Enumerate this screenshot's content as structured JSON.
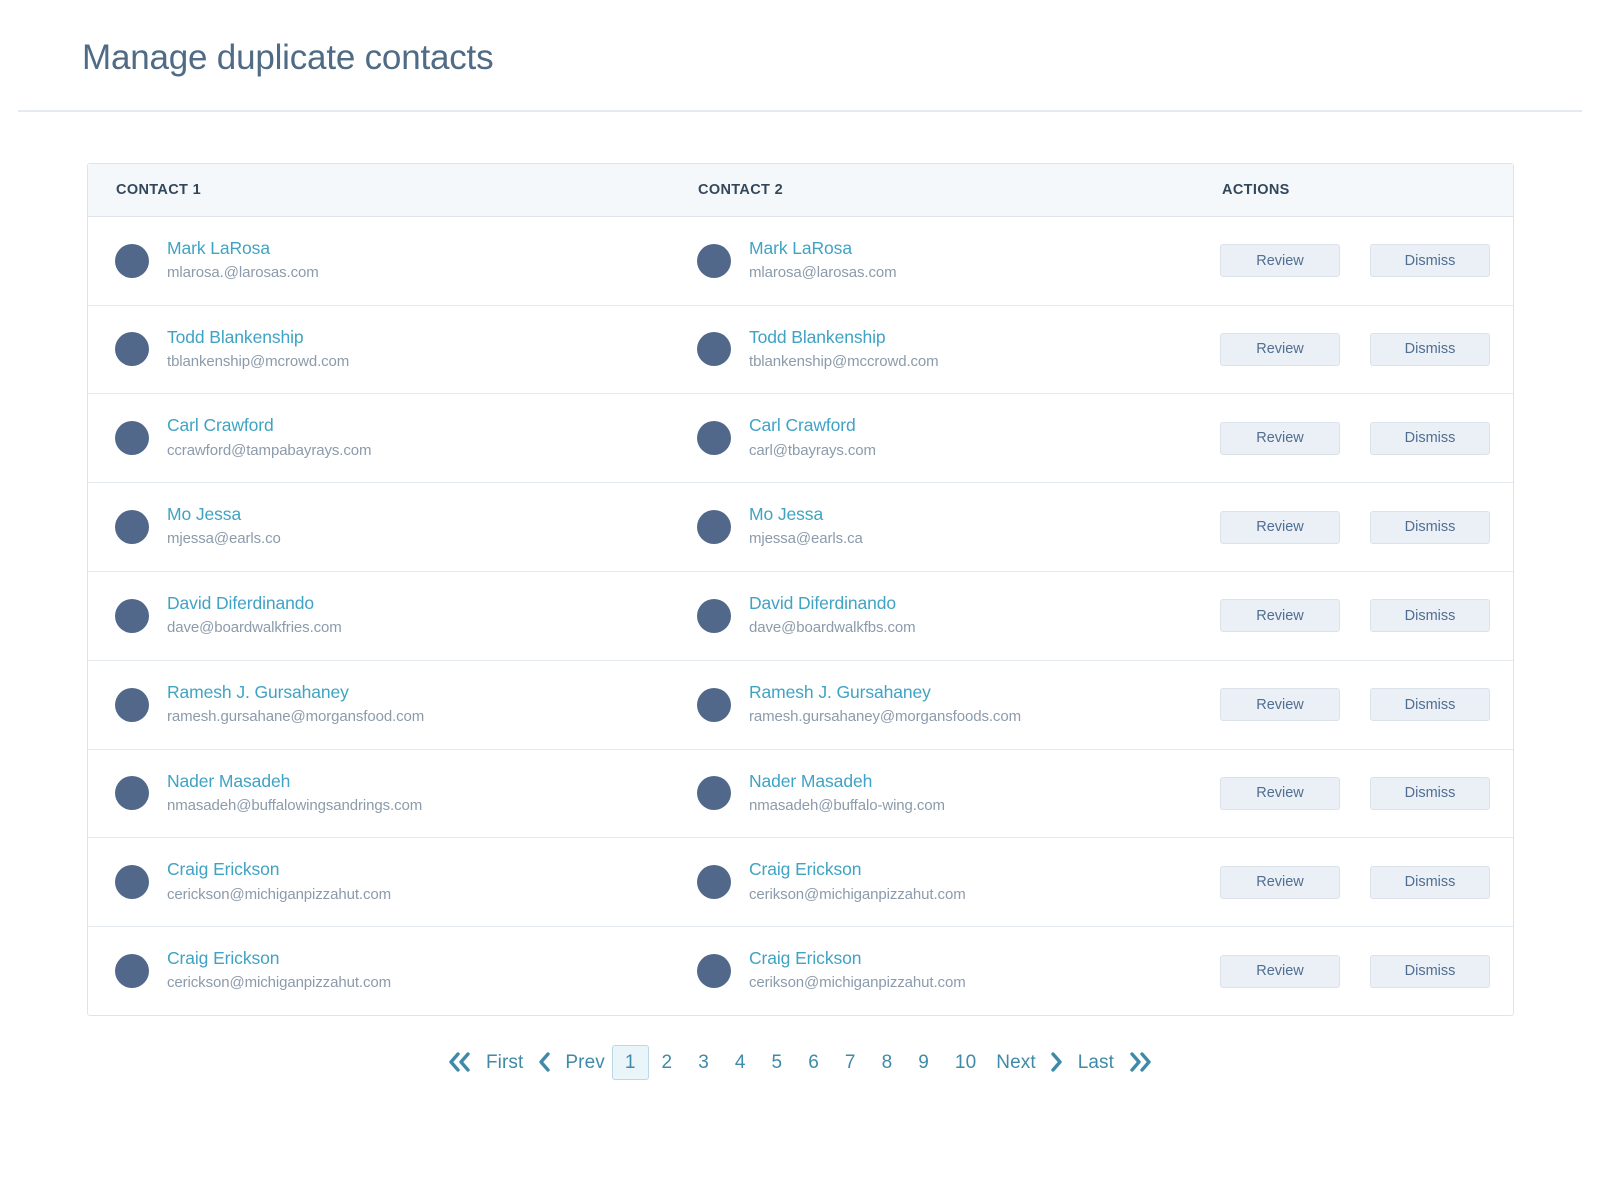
{
  "page": {
    "title": "Manage duplicate contacts"
  },
  "table": {
    "headers": {
      "contact1": "CONTACT 1",
      "contact2": "CONTACT 2",
      "actions": "ACTIONS"
    },
    "actions": {
      "review_label": "Review",
      "dismiss_label": "Dismiss"
    },
    "rows": [
      {
        "contact1": {
          "name": "Mark LaRosa",
          "email": "mlarosa.@larosas.com"
        },
        "contact2": {
          "name": "Mark LaRosa",
          "email": "mlarosa@larosas.com"
        }
      },
      {
        "contact1": {
          "name": "Todd Blankenship",
          "email": "tblankenship@mcrowd.com"
        },
        "contact2": {
          "name": "Todd Blankenship",
          "email": "tblankenship@mccrowd.com"
        }
      },
      {
        "contact1": {
          "name": "Carl Crawford",
          "email": "ccrawford@tampabayrays.com"
        },
        "contact2": {
          "name": "Carl Crawford",
          "email": "carl@tbayrays.com"
        }
      },
      {
        "contact1": {
          "name": "Mo Jessa",
          "email": "mjessa@earls.co"
        },
        "contact2": {
          "name": "Mo Jessa",
          "email": "mjessa@earls.ca"
        }
      },
      {
        "contact1": {
          "name": "David Diferdinando",
          "email": "dave@boardwalkfries.com"
        },
        "contact2": {
          "name": "David Diferdinando",
          "email": "dave@boardwalkfbs.com"
        }
      },
      {
        "contact1": {
          "name": "Ramesh J. Gursahaney",
          "email": "ramesh.gursahane@morgansfood.com"
        },
        "contact2": {
          "name": "Ramesh J. Gursahaney",
          "email": "ramesh.gursahaney@morgansfoods.com"
        }
      },
      {
        "contact1": {
          "name": "Nader Masadeh",
          "email": "nmasadeh@buffalowingsandrings.com"
        },
        "contact2": {
          "name": "Nader Masadeh",
          "email": "nmasadeh@buffalo-wing.com"
        }
      },
      {
        "contact1": {
          "name": "Craig Erickson",
          "email": "cerickson@michiganpizzahut.com"
        },
        "contact2": {
          "name": "Craig Erickson",
          "email": "cerikson@michiganpizzahut.com"
        }
      },
      {
        "contact1": {
          "name": "Craig Erickson",
          "email": "cerickson@michiganpizzahut.com"
        },
        "contact2": {
          "name": "Craig Erickson",
          "email": "cerikson@michiganpizzahut.com"
        }
      }
    ]
  },
  "pagination": {
    "first_label": "First",
    "prev_label": "Prev",
    "next_label": "Next",
    "last_label": "Last",
    "pages": [
      "1",
      "2",
      "3",
      "4",
      "5",
      "6",
      "7",
      "8",
      "9",
      "10"
    ],
    "current_page": "1"
  },
  "colors": {
    "title": "#4f6b85",
    "link": "#40a3c4",
    "avatar": "#51688a",
    "muted": "#8c9bab",
    "header_bg": "#f5f8fa",
    "border": "#dfe3eb",
    "button_bg": "#eaf0f6",
    "pagination": "#3f8aa8",
    "active_page_bg": "#eaf5f9"
  }
}
